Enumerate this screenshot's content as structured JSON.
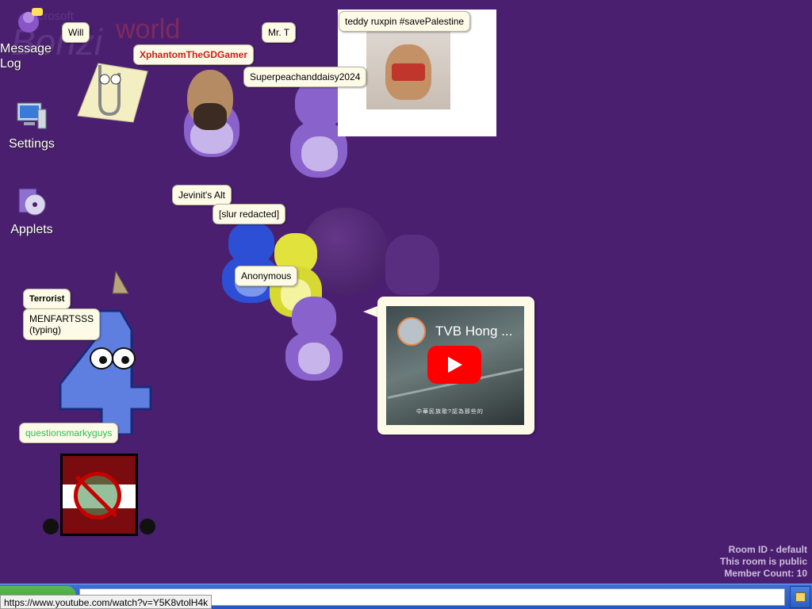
{
  "background": {
    "brand_small": "Microsoft",
    "brand_main": "Bonzi",
    "brand_world": "world",
    "color": "#4b1f6f"
  },
  "desktop_icons": [
    {
      "label": "Message Log",
      "icon": "message-log-icon"
    },
    {
      "label": "Settings",
      "icon": "settings-computer-icon"
    },
    {
      "label": "Applets",
      "icon": "applets-cd-icon"
    }
  ],
  "users": [
    {
      "name": "Will",
      "sprite": "bonzi"
    },
    {
      "name": "Mr. T",
      "sprite": "bonzi"
    },
    {
      "name": "XphantomTheGDGamer",
      "sprite": "bonzi-custom-face",
      "name_color": "#d11a1a"
    },
    {
      "name": "Superpeachanddaisy2024",
      "sprite": "bonzi"
    },
    {
      "name": "teddy ruxpin #savePalestine",
      "sprite": "image-teddy-bear"
    },
    {
      "name": "Jevinit's Alt",
      "sprite": "bonzi-blue"
    },
    {
      "name": "[slur redacted]",
      "sprite": "bonzi-blue"
    },
    {
      "name": "Anonymous",
      "sprite": "bonzi-yellow"
    },
    {
      "name": "Terrorist",
      "sprite": "paperclip-clippy"
    },
    {
      "name": "MENFARTSSS",
      "typing_status": "(typing)",
      "sprite": "number-4-character"
    },
    {
      "name": "questionsmarkyguys",
      "sprite": "ban-sign-image",
      "name_color": "#1fc45a"
    }
  ],
  "video_card": {
    "title": "TVB Hong ...",
    "subtitle_cn": "中華民族歌?認為那些的",
    "play_label": "play-icon"
  },
  "room": {
    "id_line": "Room ID - default",
    "public_line": "This room is public",
    "count_line": "Member Count: 10"
  },
  "taskbar": {
    "chat_value": "",
    "status_url": "https://www.youtube.com/watch?v=Y5K8vtolH4k"
  }
}
